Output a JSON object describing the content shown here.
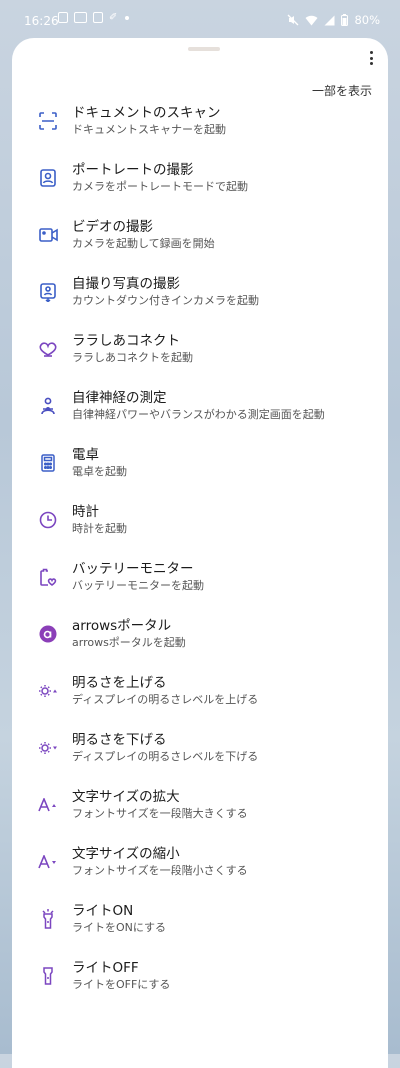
{
  "status": {
    "time": "16:26",
    "battery": "80%"
  },
  "header": {
    "show_some_label": "一部を表示"
  },
  "colors": {
    "accent": "#5a4fcf"
  },
  "items": [
    {
      "icon": "scan-icon",
      "title": "ドキュメントのスキャン",
      "sub": "ドキュメントスキャナーを起動"
    },
    {
      "icon": "portrait-camera-icon",
      "title": "ポートレートの撮影",
      "sub": "カメラをポートレートモードで起動"
    },
    {
      "icon": "video-camera-icon",
      "title": "ビデオの撮影",
      "sub": "カメラを起動して録画を開始"
    },
    {
      "icon": "selfie-icon",
      "title": "自撮り写真の撮影",
      "sub": "カウントダウン付きインカメラを起動"
    },
    {
      "icon": "heart-connect-icon",
      "title": "ララしあコネクト",
      "sub": "ララしあコネクトを起動"
    },
    {
      "icon": "person-wellness-icon",
      "title": "自律神経の測定",
      "sub": "自律神経パワーやバランスがわかる測定画面を起動"
    },
    {
      "icon": "calculator-icon",
      "title": "電卓",
      "sub": "電卓を起動"
    },
    {
      "icon": "clock-icon",
      "title": "時計",
      "sub": "時計を起動"
    },
    {
      "icon": "battery-heart-icon",
      "title": "バッテリーモニター",
      "sub": "バッテリーモニターを起動"
    },
    {
      "icon": "arrows-logo-icon",
      "title": "arrowsポータル",
      "sub": "arrowsポータルを起動"
    },
    {
      "icon": "brightness-up-icon",
      "title": "明るさを上げる",
      "sub": "ディスプレイの明るさレベルを上げる"
    },
    {
      "icon": "brightness-down-icon",
      "title": "明るさを下げる",
      "sub": "ディスプレイの明るさレベルを下げる"
    },
    {
      "icon": "text-size-up-icon",
      "title": "文字サイズの拡大",
      "sub": "フォントサイズを一段階大きくする"
    },
    {
      "icon": "text-size-down-icon",
      "title": "文字サイズの縮小",
      "sub": "フォントサイズを一段階小さくする"
    },
    {
      "icon": "flashlight-on-icon",
      "title": "ライトON",
      "sub": "ライトをONにする"
    },
    {
      "icon": "flashlight-off-icon",
      "title": "ライトOFF",
      "sub": "ライトをOFFにする"
    }
  ]
}
